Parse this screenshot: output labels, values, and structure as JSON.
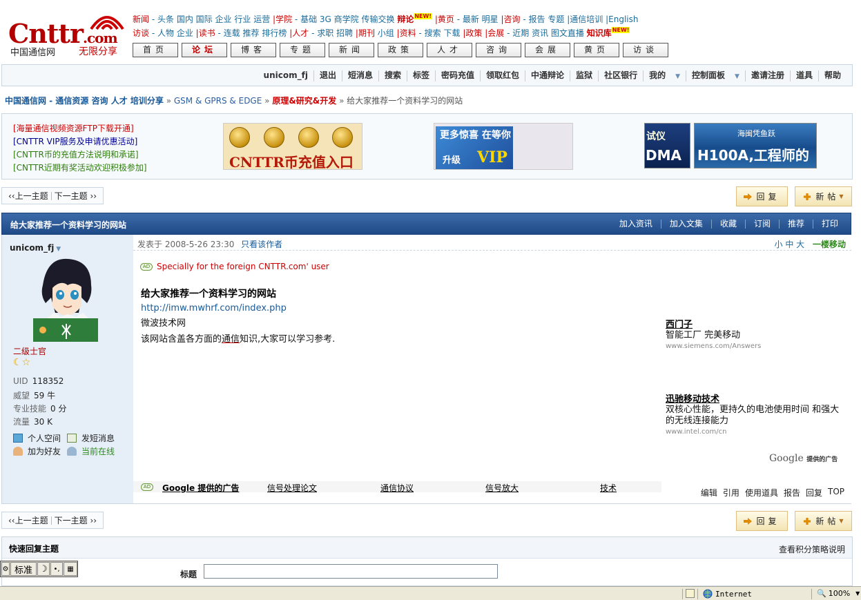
{
  "logo": {
    "brand": "Cnttr",
    "domain": ".com",
    "cn_name": "中国通信网",
    "slogan": "无限分享"
  },
  "top_nav": {
    "row1": [
      {
        "label": "新闻",
        "style": "r"
      },
      {
        "label": "- 头条"
      },
      {
        "label": "国内"
      },
      {
        "label": "国际"
      },
      {
        "label": "企业"
      },
      {
        "label": "行业"
      },
      {
        "label": "运营"
      },
      {
        "label": "|学院",
        "style": "r"
      },
      {
        "label": "- 基础"
      },
      {
        "label": "3G 商学院"
      },
      {
        "label": "传输交换"
      },
      {
        "label": "辩论",
        "style": "b",
        "new": "NEW!"
      },
      {
        "label": "|黄页",
        "style": "r"
      },
      {
        "label": "- 最新"
      },
      {
        "label": "明星"
      },
      {
        "label": "|咨询",
        "style": "r"
      },
      {
        "label": "- 报告"
      },
      {
        "label": "专题"
      },
      {
        "label": "|通信培训"
      },
      {
        "label": "|English"
      }
    ],
    "row2": [
      {
        "label": "访谈",
        "style": "r"
      },
      {
        "label": "- 人物"
      },
      {
        "label": "企业"
      },
      {
        "label": "|读书",
        "style": "r"
      },
      {
        "label": "- 连载"
      },
      {
        "label": "推荐"
      },
      {
        "label": "排行榜"
      },
      {
        "label": "|人才",
        "style": "r"
      },
      {
        "label": "- 求职"
      },
      {
        "label": "招聘"
      },
      {
        "label": "|期刊",
        "style": "r"
      },
      {
        "label": "小组"
      },
      {
        "label": "|资料",
        "style": "r"
      },
      {
        "label": "- 搜索"
      },
      {
        "label": "下载"
      },
      {
        "label": "|政策",
        "style": "r"
      },
      {
        "label": "|会展",
        "style": "r"
      },
      {
        "label": "- 近期"
      },
      {
        "label": "资讯"
      },
      {
        "label": "图文直播"
      },
      {
        "label": "知识库",
        "style": "b",
        "new": "NEW!"
      }
    ],
    "buttons": [
      "首页",
      "论坛",
      "博客",
      "专题",
      "新闻",
      "政策",
      "人才",
      "咨询",
      "会展",
      "黄页",
      "访谈"
    ]
  },
  "userbar": {
    "username": "unicom_fj",
    "items": [
      "退出",
      "短消息",
      "搜索",
      "标签",
      "密码充值",
      "领取红包",
      "中通辩论",
      "监狱",
      "社区银行",
      "我的",
      "控制面板",
      "邀请注册",
      "道具",
      "帮助"
    ]
  },
  "breadcrumb": {
    "site": "中国通信网 - 通信资源  咨询  人才  培训分享",
    "forum": "GSM & GPRS & EDGE",
    "sub": "原理&研究&开发",
    "current": "给大家推荐一个资料学习的网站",
    "sep": "»"
  },
  "promo": {
    "lines": [
      "[海量通信视频资源FTP下载开通]",
      "[CNTTR VIP服务及申请优惠活动]",
      "[CNTTR币的充值方法说明和承诺]",
      "[CNTTR近期有奖活动欢迎积极参加]"
    ],
    "coin_banner": "CNTTR币充值入口",
    "vip_banner": {
      "t1": "更多惊喜 在等你",
      "t2": "VIP",
      "t3": "升级"
    },
    "cdma_banner": {
      "t1": "试仪",
      "t2": "DMA"
    },
    "h100_banner": {
      "t1": "海闽凭鱼跃",
      "t2": "H100A,工程师的"
    }
  },
  "thread_nav": {
    "prev": "上一主题",
    "next": "下一主题",
    "prev_arrow": "‹‹",
    "next_arrow": "››"
  },
  "post_buttons": {
    "reply": "回复",
    "new": "新帖"
  },
  "post_header": {
    "title": "给大家推荐一个资料学习的网站",
    "actions": [
      "加入资讯",
      "加入文集",
      "收藏",
      "订阅",
      "推荐",
      "打印"
    ]
  },
  "author": {
    "name": "unicom_fj",
    "rank": "二级士官",
    "stars": "☾☆",
    "stats": [
      {
        "label": "UID",
        "value": "118352"
      },
      {
        "label": "威望",
        "value": "59 牛"
      },
      {
        "label": "专业技能",
        "value": "0 分"
      },
      {
        "label": "流量",
        "value": "30 K"
      }
    ],
    "links": {
      "space": "个人空间",
      "pm": "发短消息",
      "friend": "加为好友",
      "online": "当前在线"
    }
  },
  "post": {
    "posted_label": "发表于",
    "posted_time": "2008-5-26 23:30",
    "only_author": "只看该作者",
    "font_sizes": "小 中 大",
    "floor": "一楼移动",
    "ad_tag": "AD",
    "ad_text": "Specially for the foreign CNTTR.com' user",
    "title": "给大家推荐一个资料学习的网站",
    "link": "http://imw.mwhrf.com/index.php",
    "line1": "微波技术网",
    "line2a": "该网站含盖各方面的",
    "line2u": "通信",
    "line2b": "知识,大家可以学习参考."
  },
  "google_ads": [
    {
      "title": "西门子",
      "desc": "智能工厂  完美移动",
      "url": "www.siemens.com/Answers"
    },
    {
      "title": "迅驰移动技术",
      "desc": "双核心性能，更持久的电池使用时间 和强大的无线连接能力",
      "url": "www.intel.com/cn"
    }
  ],
  "google_brand": {
    "name": "Google",
    "suffix": "提供的广告"
  },
  "google_bar": {
    "tag": "AD",
    "label": "Google 提供的广告",
    "links": [
      "信号处理论文",
      "通信协议",
      "信号放大",
      "技术"
    ]
  },
  "post_actions": [
    "编辑",
    "引用",
    "使用道具",
    "报告",
    "回复",
    "TOP"
  ],
  "quick_reply": {
    "title": "快速回复主题",
    "rules": "查看积分策略说明",
    "subject_label": "标题",
    "subject_value": ""
  },
  "ime": {
    "mode": "标准"
  },
  "statusbar": {
    "zone": "Internet",
    "zoom": "100%"
  }
}
